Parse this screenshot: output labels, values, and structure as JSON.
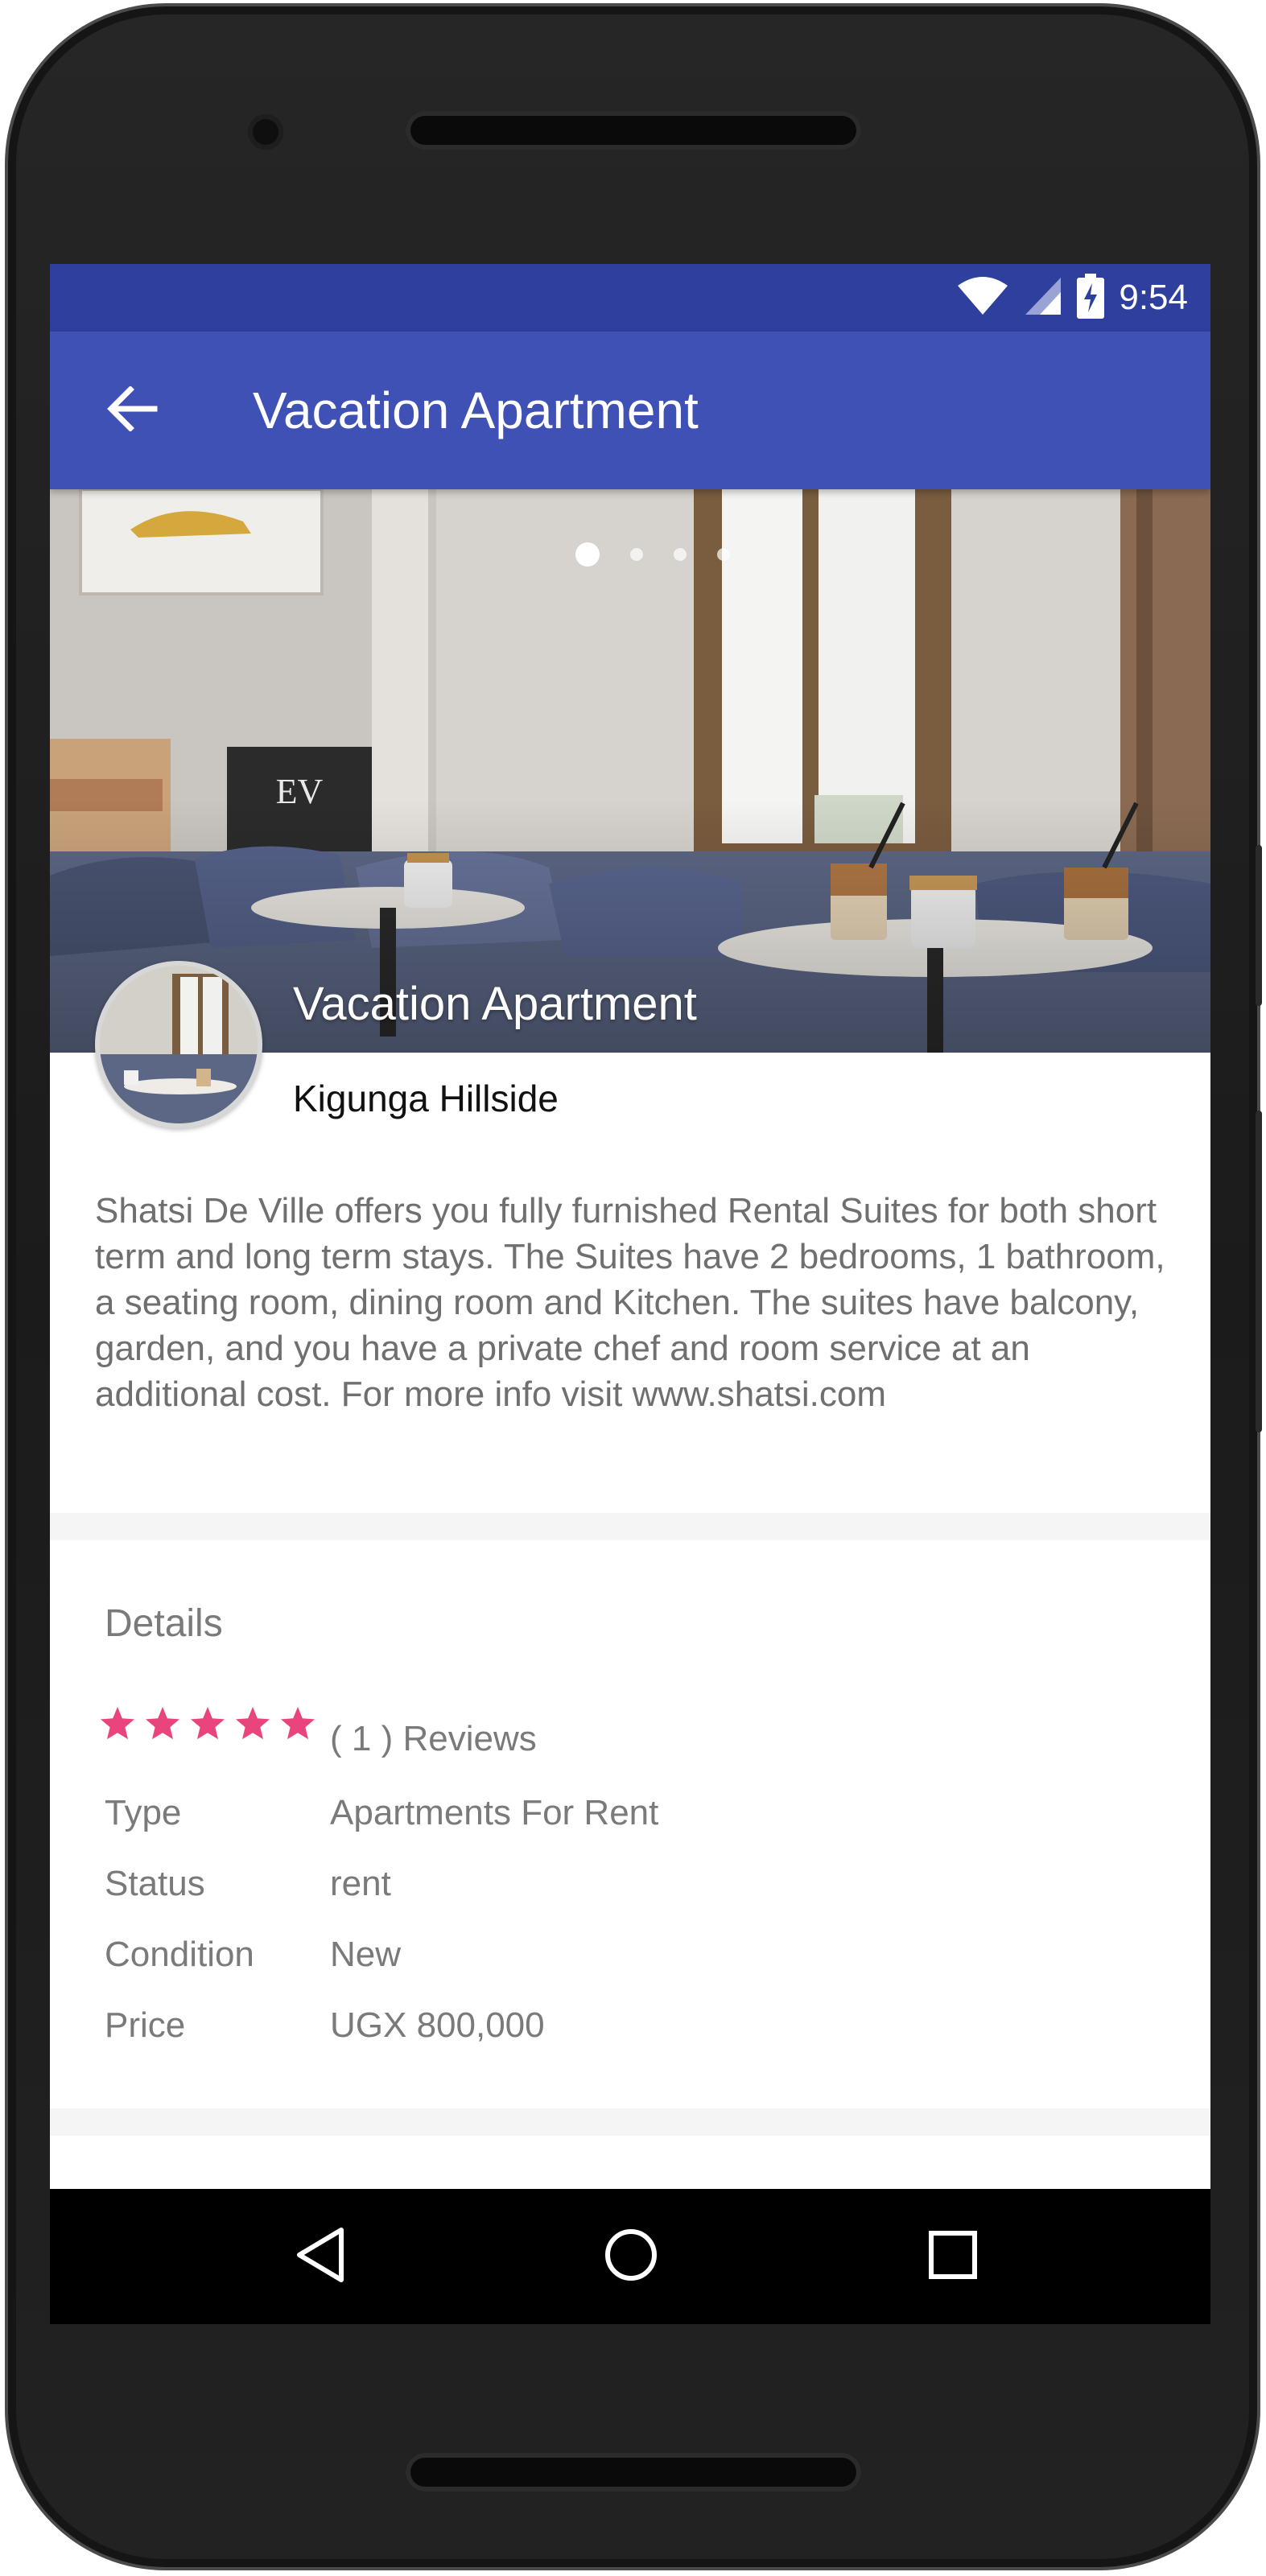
{
  "status_bar": {
    "time": "9:54"
  },
  "app_bar": {
    "title": "Vacation Apartment"
  },
  "hero": {
    "title": "Vacation Apartment",
    "location": "Kigunga Hillside",
    "slide_count": 4,
    "active_slide": 1
  },
  "description": "Shatsi De Ville offers you fully furnished Rental Suites for both short term and long term stays. The Suites have 2 bedrooms, 1 bathroom, a seating room, dining room and Kitchen. The suites have balcony, garden, and you have a private chef and room service at an additional cost. For more info visit www.shatsi.com",
  "details": {
    "title": "Details",
    "rating": 5,
    "rating_max": 5,
    "reviews_label": "( 1 ) Reviews",
    "rows": [
      {
        "key": "Type",
        "value": "Apartments For Rent"
      },
      {
        "key": "Status",
        "value": "rent"
      },
      {
        "key": "Condition",
        "value": "New"
      },
      {
        "key": "Price",
        "value": "UGX 800,000"
      }
    ]
  },
  "colors": {
    "status_bar": "#2f3f9e",
    "app_bar": "#3f51b5",
    "star": "#e9457c"
  },
  "icons": {
    "back": "arrow-back-icon",
    "wifi": "wifi-icon",
    "signal": "signal-icon",
    "battery": "battery-charging-icon",
    "nav_back": "nav-back-icon",
    "nav_home": "nav-home-icon",
    "nav_recents": "nav-recents-icon"
  }
}
